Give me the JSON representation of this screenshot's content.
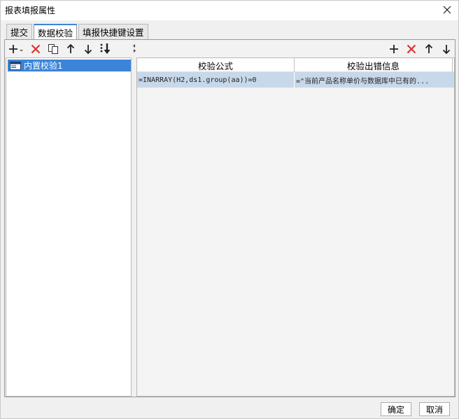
{
  "window": {
    "title": "报表填报属性"
  },
  "tabs": [
    {
      "label": "提交"
    },
    {
      "label": "数据校验"
    },
    {
      "label": "填报快捷键设置"
    }
  ],
  "left": {
    "items": [
      {
        "label": "内置校验1"
      }
    ]
  },
  "grid": {
    "columns": [
      "校验公式",
      "校验出错信息"
    ],
    "rows": [
      {
        "formula": "=INARRAY(H2,ds1.group(aa))=0",
        "message": "=\"当前产品名称单价与数据库中已有的..."
      }
    ]
  },
  "buttons": {
    "ok": "确定",
    "cancel": "取消"
  },
  "colors": {
    "selection": "#3b84d8",
    "row_selected": "#c7d8ea",
    "delete_red": "#e03030"
  }
}
